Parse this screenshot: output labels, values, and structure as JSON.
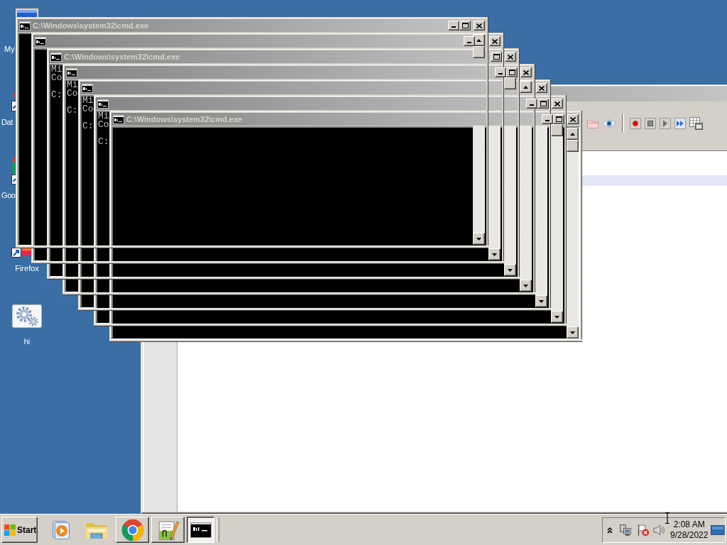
{
  "desktop_icons": [
    {
      "label": "My"
    },
    {
      "label": "Dat"
    },
    {
      "label": "Goo"
    },
    {
      "label": "Firefox"
    },
    {
      "label": "hi"
    }
  ],
  "background_window": {
    "list_rows": [
      {
        "selected": true
      }
    ]
  },
  "console_windows": [
    {
      "title": "C:\\Windows\\system32\\cmd.exe",
      "buttons": [
        {
          "kind": "minimize"
        },
        {
          "kind": "maximize"
        },
        {
          "kind": "close"
        }
      ],
      "scrollbar": {
        "up_button": true,
        "thumb": true
      }
    },
    {
      "buttons": [
        {
          "kind": "minimize"
        },
        {
          "kind": "close"
        }
      ],
      "scrollbar": {
        "up_button": false,
        "thumb": false
      }
    },
    {
      "title": "C:\\Windows\\system32\\cmd.exe",
      "buttons": [
        {
          "kind": "maximize"
        },
        {
          "kind": "close"
        }
      ],
      "output": [
        "Mi",
        "Co"
      ],
      "prompt": "C:",
      "scrollbar": {
        "up_button": false,
        "thumb": true
      }
    },
    {
      "buttons": [
        {
          "kind": "minimize"
        },
        {
          "kind": "maximize"
        },
        {
          "kind": "close"
        }
      ],
      "output": [
        "Mi",
        "Co"
      ],
      "prompt": "C:",
      "scrollbar": {
        "up_button": true,
        "thumb": false
      }
    },
    {
      "buttons": [
        {
          "kind": "close"
        }
      ],
      "output": [
        "Mi",
        "Co"
      ],
      "prompt": "C:",
      "scrollbar": {
        "up_button": false,
        "thumb": false
      }
    },
    {
      "buttons": [
        {
          "kind": "minimize"
        },
        {
          "kind": "maximize"
        },
        {
          "kind": "close"
        }
      ],
      "output": [
        "Mi",
        "Co"
      ],
      "prompt": "C:",
      "scrollbar": {
        "up_button": false,
        "thumb": true
      }
    },
    {
      "title": "C:\\Windows\\system32\\cmd.exe",
      "buttons": [
        {
          "kind": "minimize"
        },
        {
          "kind": "maximize"
        },
        {
          "kind": "close"
        }
      ],
      "scrollbar": {
        "up_button": true,
        "thumb": true
      }
    }
  ],
  "taskbar": {
    "start": "Start",
    "tasks": [
      {
        "selected": false
      },
      {
        "selected": false
      },
      {
        "selected": true
      }
    ],
    "clock": {
      "time": "2:08 AM",
      "date": "9/28/2022"
    }
  }
}
